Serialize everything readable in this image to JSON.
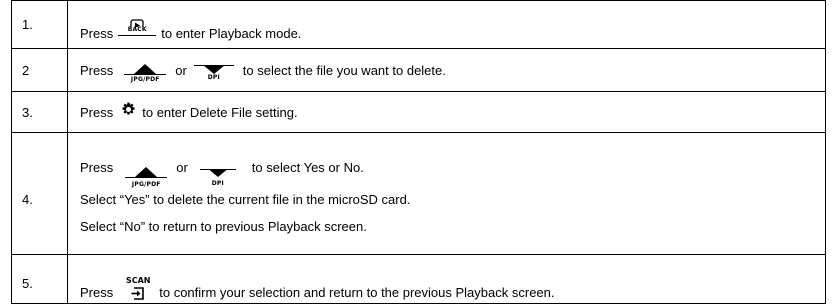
{
  "steps": [
    {
      "number": "1.",
      "press": "Press",
      "back_label": "BACK",
      "rest": "to enter Playback mode."
    },
    {
      "number": "2",
      "press": "Press",
      "up_label": "JPG/PDF",
      "or": "or",
      "down_label": "DPI",
      "rest": "to select the file you want to delete."
    },
    {
      "number": "3.",
      "press": "Press",
      "rest": "to enter Delete File setting."
    },
    {
      "number": "4.",
      "press": "Press",
      "up_label": "JPG/PDF",
      "or": "or",
      "down_label": "DPI",
      "rest": "to select Yes or No.",
      "yes_line": "Select “Yes” to delete the current file in the microSD card.",
      "no_line": "Select “No” to return to previous Playback screen."
    },
    {
      "number": "5.",
      "press": "Press",
      "scan_label": "SCAN",
      "rest": "to confirm your selection and return to the previous Playback screen."
    }
  ],
  "icons": {
    "playback": "playback-icon",
    "up": "up-triangle-icon",
    "down": "down-triangle-icon",
    "gear": "gear-icon",
    "enter": "enter-icon"
  }
}
